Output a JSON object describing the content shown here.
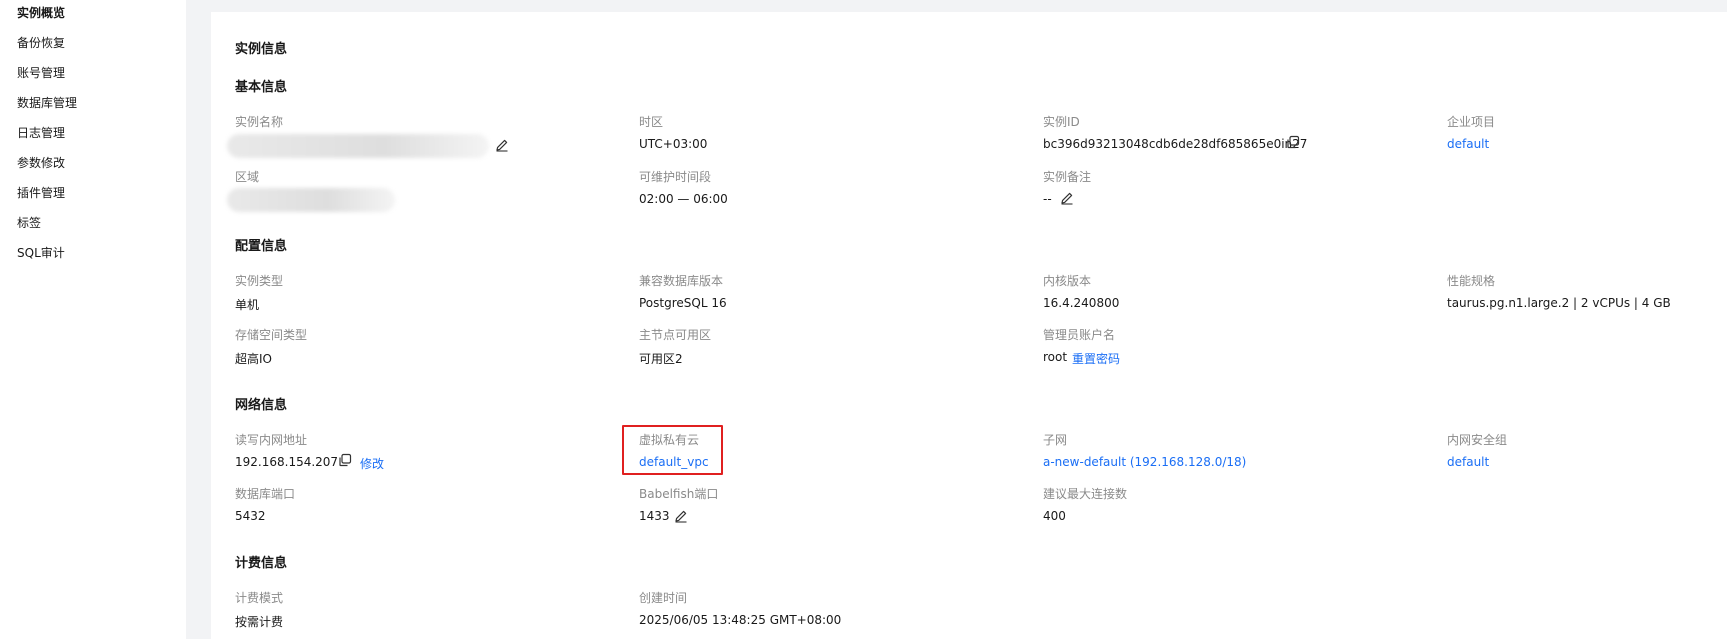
{
  "sidebar": {
    "items": [
      {
        "label": "实例概览"
      },
      {
        "label": "备份恢复"
      },
      {
        "label": "账号管理"
      },
      {
        "label": "数据库管理"
      },
      {
        "label": "日志管理"
      },
      {
        "label": "参数修改"
      },
      {
        "label": "插件管理"
      },
      {
        "label": "标签"
      },
      {
        "label": "SQL审计"
      }
    ]
  },
  "main": {
    "title": "实例信息",
    "basic": {
      "title": "基本信息",
      "instance_name": {
        "label": "实例名称"
      },
      "timezone": {
        "label": "时区",
        "value": "UTC+03:00"
      },
      "instance_id": {
        "label": "实例ID",
        "value": "bc396d93213048cdb6de28df685865e0in27"
      },
      "enterprise_project": {
        "label": "企业项目",
        "value": "default"
      },
      "region": {
        "label": "区域"
      },
      "maintenance_window": {
        "label": "可维护时间段",
        "value": "02:00 — 06:00"
      },
      "remark": {
        "label": "实例备注",
        "value": "--"
      }
    },
    "config": {
      "title": "配置信息",
      "instance_type": {
        "label": "实例类型",
        "value": "单机"
      },
      "db_version": {
        "label": "兼容数据库版本",
        "value": "PostgreSQL 16"
      },
      "kernel_version": {
        "label": "内核版本",
        "value": "16.4.240800"
      },
      "flavor": {
        "label": "性能规格",
        "value": "taurus.pg.n1.large.2 | 2 vCPUs | 4 GB"
      },
      "storage_type": {
        "label": "存储空间类型",
        "value": "超高IO"
      },
      "primary_az": {
        "label": "主节点可用区",
        "value": "可用区2"
      },
      "admin_account": {
        "label": "管理员账户名",
        "value": "root",
        "reset_label": "重置密码"
      }
    },
    "network": {
      "title": "网络信息",
      "private_ip": {
        "label": "读写内网地址",
        "value": "192.168.154.207",
        "modify_label": "修改"
      },
      "vpc": {
        "label": "虚拟私有云",
        "value": "default_vpc"
      },
      "subnet": {
        "label": "子网",
        "value": "a-new-default (192.168.128.0/18)"
      },
      "security_group": {
        "label": "内网安全组",
        "value": "default"
      },
      "db_port": {
        "label": "数据库端口",
        "value": "5432"
      },
      "babelfish_port": {
        "label": "Babelfish端口",
        "value": "1433"
      },
      "max_connections": {
        "label": "建议最大连接数",
        "value": "400"
      }
    },
    "billing": {
      "title": "计费信息",
      "mode": {
        "label": "计费模式",
        "value": "按需计费"
      },
      "created": {
        "label": "创建时间",
        "value": "2025/06/05 13:48:25 GMT+08:00"
      }
    }
  },
  "colors": {
    "link": "#1a6ef5",
    "highlight": "#e02020",
    "background": "#f2f3f5"
  }
}
